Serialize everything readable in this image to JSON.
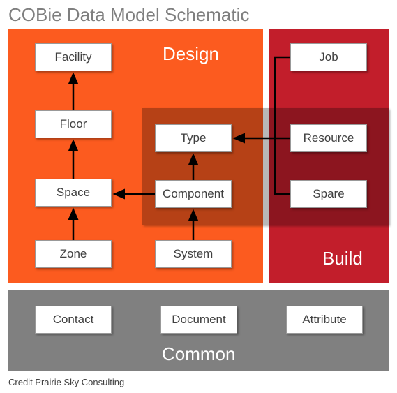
{
  "title": "COBie Data Model Schematic",
  "credit": "Credit Prairie Sky Consulting",
  "regions": {
    "design": {
      "label": "Design"
    },
    "build": {
      "label": "Build"
    },
    "common": {
      "label": "Common"
    }
  },
  "nodes": {
    "facility": "Facility",
    "floor": "Floor",
    "space": "Space",
    "zone": "Zone",
    "type": "Type",
    "component": "Component",
    "system": "System",
    "job": "Job",
    "resource": "Resource",
    "spare": "Spare",
    "contact": "Contact",
    "document": "Document",
    "attribute": "Attribute"
  },
  "arrows": [
    {
      "from": "zone",
      "to": "space"
    },
    {
      "from": "space",
      "to": "floor"
    },
    {
      "from": "floor",
      "to": "facility"
    },
    {
      "from": "component",
      "to": "space"
    },
    {
      "from": "system",
      "to": "component"
    },
    {
      "from": "component",
      "to": "type"
    },
    {
      "from": "job",
      "to": "type"
    },
    {
      "from": "resource",
      "to": "type",
      "via": "job"
    },
    {
      "from": "spare",
      "to": "type",
      "via": "job"
    }
  ],
  "colors": {
    "design": "#fc5b1f",
    "build": "#c21e2b",
    "common": "#808080",
    "arrow": "#000000"
  }
}
